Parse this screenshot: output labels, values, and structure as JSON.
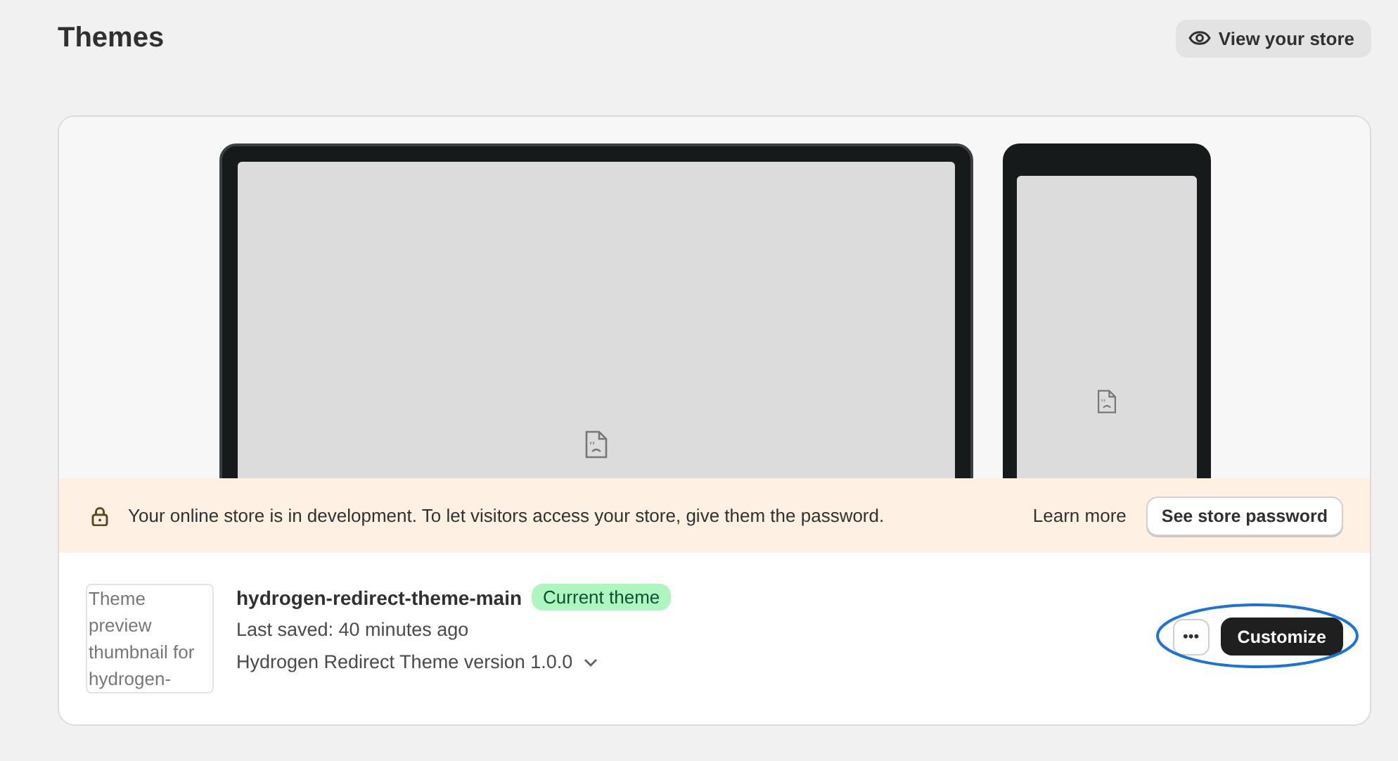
{
  "page": {
    "title": "Themes"
  },
  "header_action": {
    "label": "View your store"
  },
  "banner": {
    "message": "Your online store is in development. To let visitors access your store, give them the password.",
    "link": "Learn more",
    "button": "See store password"
  },
  "theme": {
    "thumbnail_alt": "Theme preview thumbnail for hydrogen-",
    "name": "hydrogen-redirect-theme-main",
    "badge": "Current theme",
    "last_saved": "Last saved: 40 minutes ago",
    "version": "Hydrogen Redirect Theme version 1.0.0",
    "more_button": "•••",
    "primary_button": "Customize"
  }
}
